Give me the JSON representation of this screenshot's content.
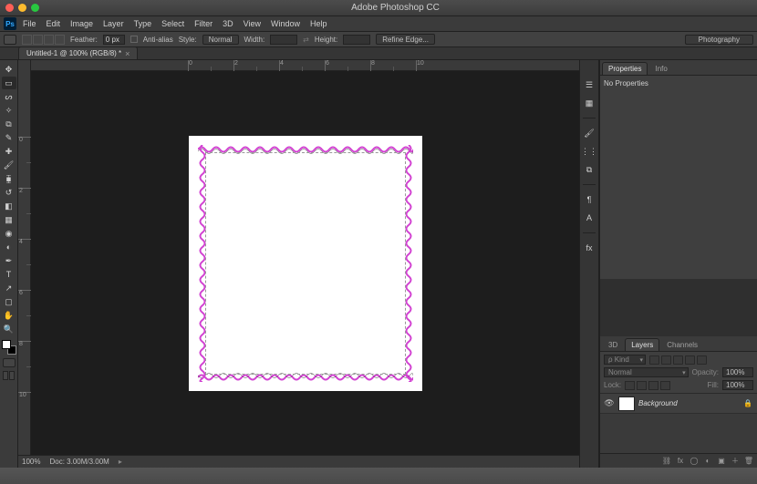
{
  "window": {
    "title": "Adobe Photoshop CC"
  },
  "menu": {
    "items": [
      "File",
      "Edit",
      "Image",
      "Layer",
      "Type",
      "Select",
      "Filter",
      "3D",
      "View",
      "Window",
      "Help"
    ]
  },
  "options": {
    "feather_label": "Feather:",
    "feather_value": "0 px",
    "antialias_label": "Anti-alias",
    "style_label": "Style:",
    "style_value": "Normal",
    "width_label": "Width:",
    "height_label": "Height:",
    "refine_edge": "Refine Edge...",
    "workspace": "Photography"
  },
  "document": {
    "tab_title": "Untitled-1 @ 100% (RGB/8) *",
    "zoom": "100%",
    "doc_size": "Doc: 3.00M/3.00M"
  },
  "ruler": {
    "h": [
      "0",
      "2",
      "4",
      "6",
      "8",
      "10"
    ],
    "v": [
      "0",
      "2",
      "4",
      "6",
      "8",
      "10"
    ]
  },
  "tools": [
    "move",
    "marquee",
    "lasso",
    "wand",
    "crop",
    "eyedropper",
    "heal",
    "brush",
    "stamp",
    "history",
    "eraser",
    "gradient",
    "blur",
    "dodge",
    "pen",
    "type",
    "path",
    "shape",
    "hand",
    "zoom"
  ],
  "dock": {
    "col1": [
      "history",
      "actions"
    ],
    "col2": [
      "swatches",
      "brush",
      "brush2",
      "clone",
      "paragraph",
      "char",
      "styles"
    ]
  },
  "panels": {
    "properties": {
      "tabs": [
        "Properties",
        "Info"
      ],
      "doc_type": "No Properties"
    },
    "layers": {
      "tabs": [
        "3D",
        "Layers",
        "Channels"
      ],
      "blend_mode": "Normal",
      "opacity_label": "Opacity:",
      "opacity_value": "100%",
      "lock_label": "Lock:",
      "fill_label": "Fill:",
      "fill_value": "100%",
      "items": [
        {
          "name": "Background",
          "locked": true
        }
      ]
    }
  }
}
